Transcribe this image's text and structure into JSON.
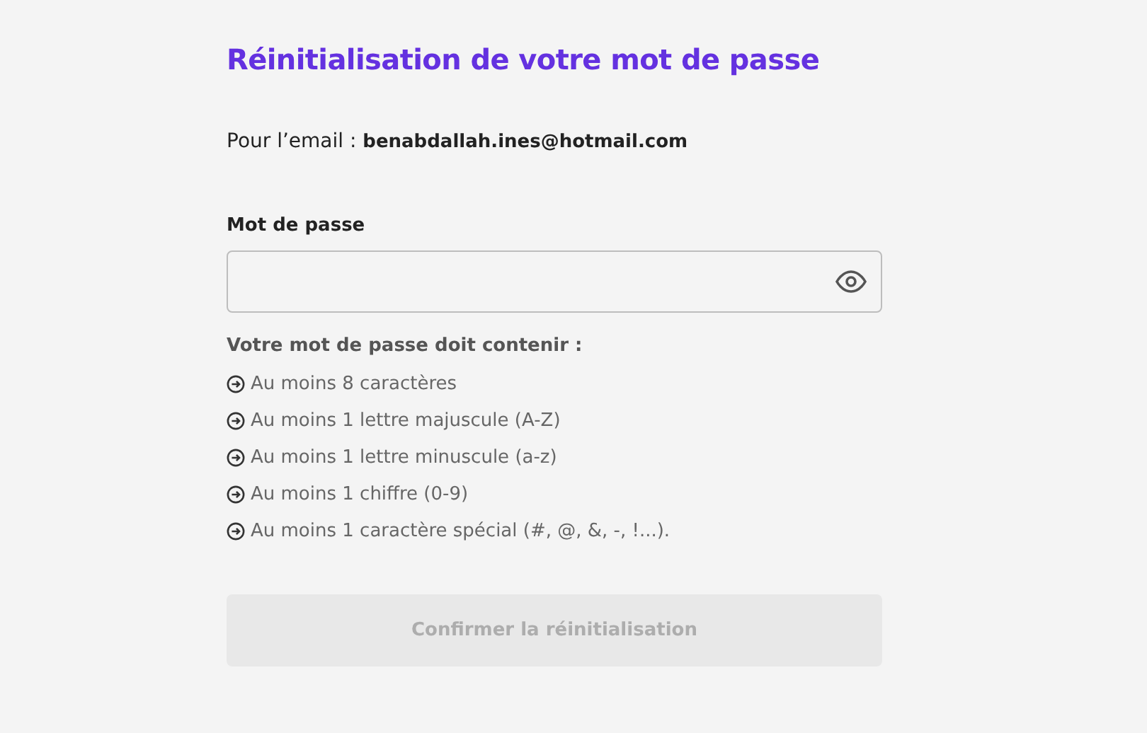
{
  "title": "Réinitialisation de votre mot de passe",
  "email_line": "Pour l’email : **benabdallah.ines@hotmail.com**",
  "password": {
    "label": "Mot de passe"
  },
  "requirements": {
    "heading": "Votre mot de passe doit contenir :",
    "items": [
      {
        "text": "Au moins 8 caractères"
      },
      {
        "text": "Au moins 1 lettre majuscule (A-Z)"
      },
      {
        "text": "Au moins 1 lettre minuscule (a-z)"
      },
      {
        "text": "Au moins 1 chiffre (0-9)"
      },
      {
        "text": "Au moins 1 caractère spécial (#, @, &, -, !...)."
      }
    ]
  },
  "submit": {
    "label": "Confirmer la réinitialisation",
    "disabled": true
  }
}
